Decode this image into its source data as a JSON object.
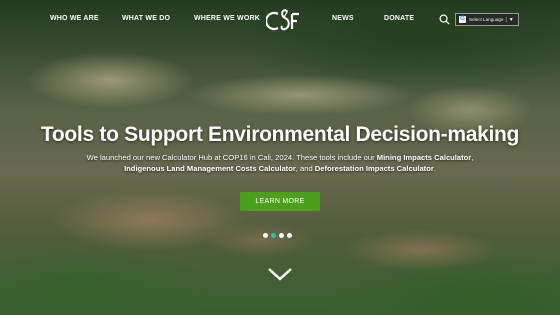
{
  "nav": {
    "items": [
      "WHO WE ARE",
      "WHAT WE DO",
      "WHERE WE WORK",
      "NEWS",
      "DONATE"
    ],
    "logo_text": "CSF",
    "search_icon": "search-icon",
    "language": {
      "label": "Select Language",
      "separator": "|",
      "caret": "▼",
      "icon": "google-translate-icon"
    }
  },
  "hero": {
    "title": "Tools to Support Environmental Decision-making",
    "line1_prefix": "We launched our new Calculator Hub at COP16 in Cali, 2024. These tools include our ",
    "line1_bold": "Mining Impacts Calculator",
    "line1_suffix": ",",
    "line2_bold1": "Indigenous Land Management Costs Calculator",
    "line2_mid": ", and ",
    "line2_bold2": "Deforestation Impacts Calculator",
    "line2_suffix": ".",
    "button": "LEARN MORE",
    "slide_count": 4,
    "active_slide": 2,
    "scroll_icon": "chevron-down-icon"
  },
  "colors": {
    "button": "#4aa01a",
    "active_dot": "#2ec2a8",
    "text": "#ffffff"
  }
}
